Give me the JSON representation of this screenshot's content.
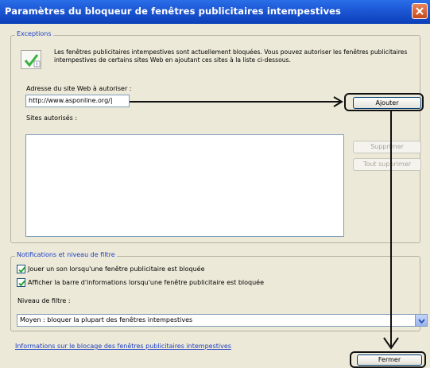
{
  "window": {
    "title": "Paramètres du bloqueur de fenêtres publicitaires intempestives"
  },
  "exceptions": {
    "group_label": "Exceptions",
    "description": "Les fenêtres publicitaires intempestives sont actuellement bloquées. Vous pouvez autoriser les fenêtres publicitaires intempestives de certains sites Web en ajoutant ces sites à la liste ci-dessous.",
    "address_label": "Adresse du site Web à autoriser :",
    "address_value": "http://www.asponline.org/|",
    "add_button": "Ajouter",
    "allowed_label": "Sites autorisés :",
    "allowed_sites": [],
    "remove_button": "Supprimer",
    "remove_all_button": "Tout supprimer"
  },
  "notifications": {
    "group_label": "Notifications et niveau de filtre",
    "checkbox_sound": {
      "label": "Jouer un son lorsqu'une fenêtre publicitaire est bloquée",
      "checked": true
    },
    "checkbox_infobar": {
      "label": "Afficher la barre d'informations lorsqu'une fenêtre publicitaire est bloquée",
      "checked": true
    },
    "filter_label": "Niveau de filtre :",
    "filter_value": "Moyen : bloquer la plupart des fenêtres intempestives"
  },
  "footer": {
    "info_link": "Informations sur le blocage des fenêtres publicitaires intempestives",
    "close_button": "Fermer"
  },
  "colors": {
    "titlebar": "#1c56d4",
    "dialog_bg": "#ece9d8",
    "section_label": "#1a3fc8",
    "annotation": "#111111"
  },
  "icons": {
    "close": "close-x-icon",
    "info": "info-check-icon",
    "dropdown": "chevron-down-icon",
    "checkbox": "checkmark-icon"
  }
}
